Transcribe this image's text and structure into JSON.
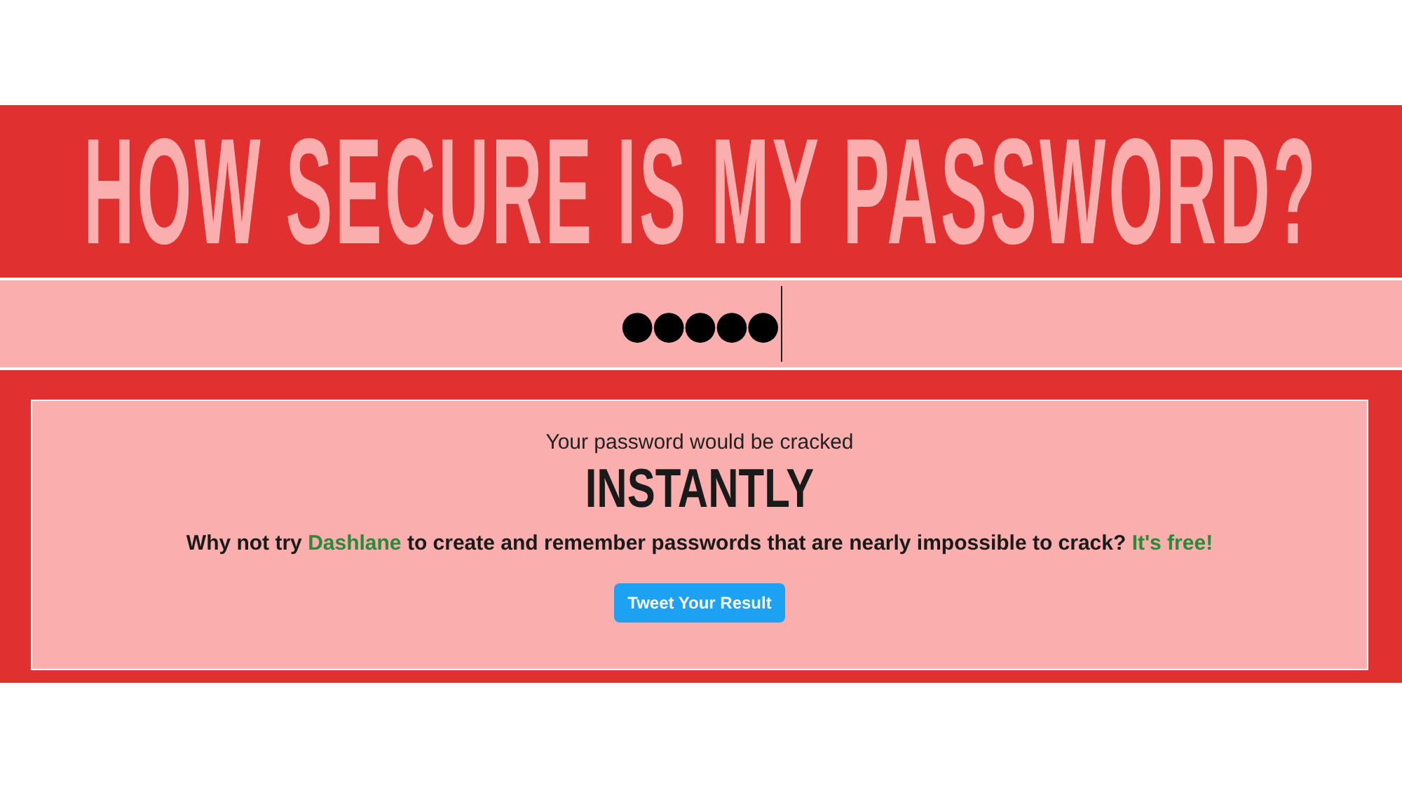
{
  "title": "HOW SECURE IS MY PASSWORD?",
  "password_field": {
    "value": "●●●●●"
  },
  "result": {
    "intro": "Your password would be cracked",
    "time": "INSTANTLY",
    "offer": [
      {
        "kind": "text",
        "text": "Why not try "
      },
      {
        "kind": "link",
        "text": "Dashlane"
      },
      {
        "kind": "text",
        "text": " to create and remember passwords that are nearly impossible to crack? "
      },
      {
        "kind": "link",
        "text": "It's free!"
      }
    ],
    "button": "Tweet Your Result"
  }
}
